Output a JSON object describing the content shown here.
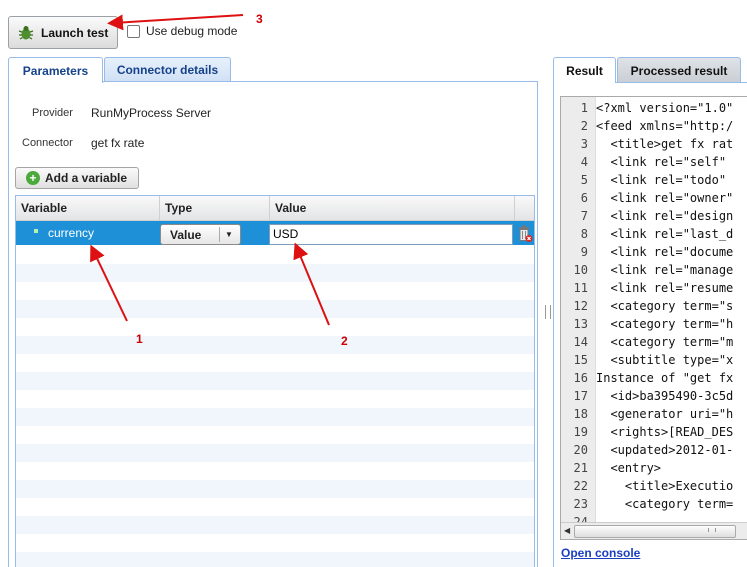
{
  "toolbar": {
    "launch_label": "Launch test",
    "debug_label": "Use debug mode",
    "debug_checked": false
  },
  "left_tabs": [
    {
      "label": "Parameters",
      "active": true
    },
    {
      "label": "Connector details",
      "active": false
    }
  ],
  "info": {
    "provider_label": "Provider",
    "provider_value": "RunMyProcess Server",
    "connector_label": "Connector",
    "connector_value": "get fx rate"
  },
  "add_variable_label": "Add a variable",
  "grid": {
    "columns": [
      "Variable",
      "Type",
      "Value"
    ],
    "rows": [
      {
        "variable": "currency",
        "type": "Value",
        "value": "USD"
      }
    ]
  },
  "right_tabs": [
    {
      "label": "Result",
      "active": true
    },
    {
      "label": "Processed result",
      "active": false
    }
  ],
  "code_lines": [
    {
      "n": "1",
      "text": "<?xml version=\"1.0\""
    },
    {
      "n": "2",
      "text": "<feed xmlns=\"http:/"
    },
    {
      "n": "3",
      "text": "  <title>get fx rat"
    },
    {
      "n": "4",
      "text": "  <link rel=\"self\""
    },
    {
      "n": "5",
      "text": "  <link rel=\"todo\""
    },
    {
      "n": "6",
      "text": "  <link rel=\"owner\""
    },
    {
      "n": "7",
      "text": "  <link rel=\"design"
    },
    {
      "n": "8",
      "text": "  <link rel=\"last_d"
    },
    {
      "n": "9",
      "text": "  <link rel=\"docume"
    },
    {
      "n": "10",
      "text": "  <link rel=\"manage"
    },
    {
      "n": "11",
      "text": "  <link rel=\"resume"
    },
    {
      "n": "12",
      "text": "  <category term=\"s"
    },
    {
      "n": "13",
      "text": "  <category term=\"h"
    },
    {
      "n": "14",
      "text": "  <category term=\"m"
    },
    {
      "n": "15",
      "text": "  <subtitle type=\"x"
    },
    {
      "n": "16",
      "text": "Instance of \"get fx"
    },
    {
      "n": "17",
      "text": "  <id>ba395490-3c5d"
    },
    {
      "n": "18",
      "text": "  <generator uri=\"h"
    },
    {
      "n": "19",
      "text": "  <rights>[READ_DES"
    },
    {
      "n": "20",
      "text": "  <updated>2012-01-"
    },
    {
      "n": "21",
      "text": "  <entry>"
    },
    {
      "n": "22",
      "text": "    <title>Executio"
    },
    {
      "n": "23",
      "text": "    <category term="
    },
    {
      "n": "24",
      "text": ""
    }
  ],
  "open_console_label": "Open console",
  "annotations": [
    "1",
    "2",
    "3"
  ],
  "colors": {
    "selection": "#1e90d8",
    "tab_border": "#99bbe8",
    "annotation": "#dd1111"
  }
}
